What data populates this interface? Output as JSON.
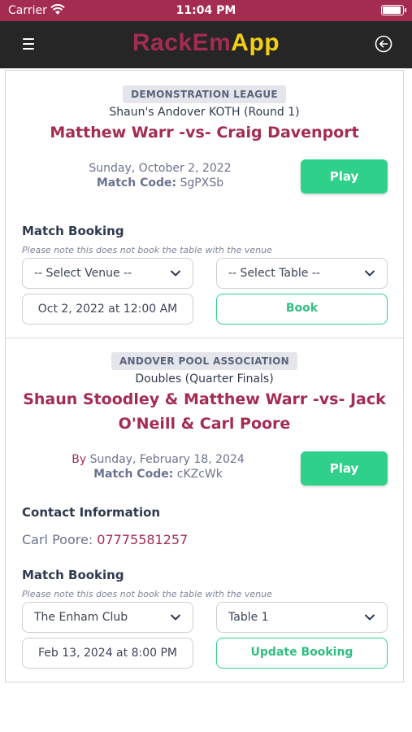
{
  "status_bar": {
    "carrier": "Carrier",
    "time": "11:04 PM"
  },
  "nav": {
    "logo_part1": "RackEm",
    "logo_part2": "App",
    "menu_icon": "hamburger-icon",
    "back_icon": "circle-arrow-left-icon"
  },
  "colors": {
    "brand": "#a42c51",
    "accent_yellow": "#f2cf16",
    "play_green": "#2fd08a",
    "nav_bg": "#262626"
  },
  "matches": [
    {
      "league": "DEMONSTRATION LEAGUE",
      "competition": "Shaun's Andover KOTH (Round 1)",
      "title_line1": "Matthew Warr -vs- Craig Davenport",
      "date": "Sunday, October 2, 2022",
      "match_code_label": "Match Code:",
      "match_code": "SgPXSb",
      "play_label": "Play",
      "booking": {
        "heading": "Match Booking",
        "note": "Please note this does not book the table with the venue",
        "venue": "-- Select Venue --",
        "table": "-- Select Table --",
        "datetime": "Oct 2, 2022 at 12:00 AM",
        "action_label": "Book"
      }
    },
    {
      "league": "ANDOVER POOL ASSOCIATION",
      "competition": "Doubles (Quarter Finals)",
      "title_line1": "Shaun Stoodley & Matthew Warr -vs- Jack",
      "title_line2": "O'Neill & Carl Poore",
      "by_label": "By",
      "date": "Sunday, February 18, 2024",
      "match_code_label": "Match Code:",
      "match_code": "cKZcWk",
      "play_label": "Play",
      "contact": {
        "heading": "Contact Information",
        "name": "Carl Poore:",
        "phone": "07775581257"
      },
      "booking": {
        "heading": "Match Booking",
        "note": "Please note this does not book the table with the venue",
        "venue": "The Enham Club",
        "table": "Table 1",
        "datetime": "Feb 13, 2024 at 8:00 PM",
        "action_label": "Update Booking"
      }
    }
  ]
}
